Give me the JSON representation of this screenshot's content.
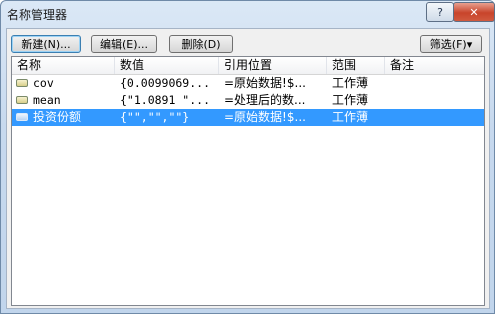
{
  "window": {
    "title": "名称管理器",
    "help_label": "?",
    "close_label": "✕"
  },
  "toolbar": {
    "new_label": "新建(N)...",
    "edit_label": "编辑(E)...",
    "delete_label": "删除(D)",
    "filter_label": "筛选(F)▾"
  },
  "table": {
    "columns": [
      "名称",
      "数值",
      "引用位置",
      "范围",
      "备注"
    ],
    "rows": [
      {
        "name": "cov",
        "value": "{0.0099069...",
        "refers_to": "=原始数据!$...",
        "scope": "工作薄",
        "comment": "",
        "selected": false
      },
      {
        "name": "mean",
        "value": "{\"1.0891 \"...",
        "refers_to": "=处理后的数...",
        "scope": "工作薄",
        "comment": "",
        "selected": false
      },
      {
        "name": "投资份额",
        "value": "{\"\",\"\",\"\"}",
        "refers_to": "=原始数据!$...",
        "scope": "工作薄",
        "comment": "",
        "selected": true
      }
    ]
  }
}
